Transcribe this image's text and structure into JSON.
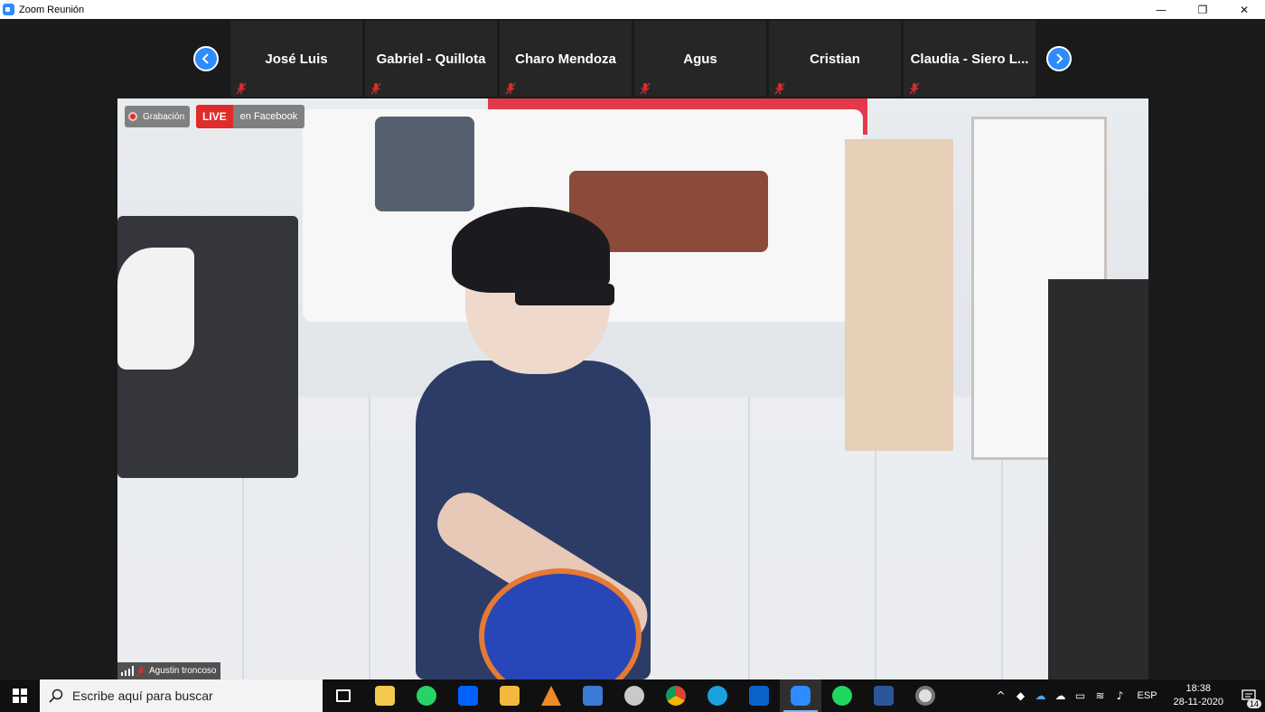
{
  "window": {
    "title": "Zoom Reunión",
    "minimize": "—",
    "maximize": "❐",
    "close": "✕"
  },
  "gallery": {
    "participants": [
      {
        "name": "José Luis"
      },
      {
        "name": "Gabriel - Quillota"
      },
      {
        "name": "Charo Mendoza"
      },
      {
        "name": "Agus"
      },
      {
        "name": "Cristian"
      },
      {
        "name": "Claudia - Siero L..."
      }
    ]
  },
  "video": {
    "recording_label": "Grabación",
    "live_label": "LIVE",
    "live_destination": "en Facebook",
    "speaker_name": "Agustin troncoso"
  },
  "taskbar": {
    "search_placeholder": "Escribe aquí para buscar",
    "language": "ESP",
    "time": "18:38",
    "date": "28-11-2020",
    "notifications": "14",
    "apps": [
      {
        "name": "task-view",
        "color": "#ffffff"
      },
      {
        "name": "microsoft-store",
        "color": "#f2c94c"
      },
      {
        "name": "whatsapp",
        "color": "#25d366"
      },
      {
        "name": "dropbox",
        "color": "#0061ff"
      },
      {
        "name": "file-explorer",
        "color": "#f4b83f"
      },
      {
        "name": "vlc",
        "color": "#f08a24"
      },
      {
        "name": "app-blue",
        "color": "#3a7bd5"
      },
      {
        "name": "app-gray",
        "color": "#c9c9c9"
      },
      {
        "name": "chrome",
        "color": "#db4437"
      },
      {
        "name": "edge",
        "color": "#1aa0e0"
      },
      {
        "name": "outlook",
        "color": "#0a64c8"
      },
      {
        "name": "zoom",
        "color": "#2d8cff"
      },
      {
        "name": "spotify",
        "color": "#1ed760"
      },
      {
        "name": "word",
        "color": "#2b579a"
      },
      {
        "name": "media-player",
        "color": "#e0e0e0"
      }
    ]
  },
  "colors": {
    "accent": "#2d8cff",
    "live_red": "#e02b2b",
    "mute_red": "#e02b2b"
  }
}
